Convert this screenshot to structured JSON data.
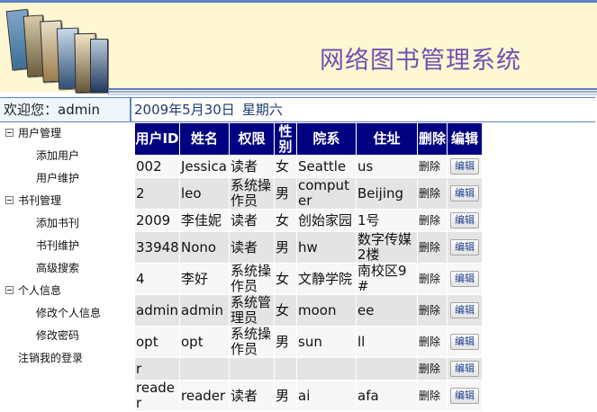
{
  "header": {
    "title": "网络图书管理系统",
    "title_color": "#7050b4",
    "stripe_color": "#5c82c4"
  },
  "welcome": {
    "greeting": "欢迎您：admin",
    "date": "2009年5月30日",
    "weekday": "星期六"
  },
  "sidebar": {
    "groups": [
      {
        "label": "用户管理",
        "items": [
          {
            "label": "添加用户"
          },
          {
            "label": "用户维护"
          }
        ]
      },
      {
        "label": "书刊管理",
        "items": [
          {
            "label": "添加书刊"
          },
          {
            "label": "书刊维护"
          },
          {
            "label": "高级搜索"
          }
        ]
      },
      {
        "label": "个人信息",
        "items": [
          {
            "label": "修改个人信息"
          },
          {
            "label": "修改密码"
          }
        ]
      }
    ],
    "logout": "注销我的登录"
  },
  "table": {
    "headers": {
      "id": "用户ID",
      "name": "姓名",
      "role": "权限",
      "gender": "性别",
      "dept": "院系",
      "address": "住址",
      "delete": "删除",
      "edit": "编辑"
    },
    "delete_label": "删除",
    "edit_label": "编辑",
    "rows": [
      {
        "id": "002",
        "name": "Jessica",
        "role": "读者",
        "gender": "女",
        "dept": "Seattle",
        "address": "us"
      },
      {
        "id": "2",
        "name": "leo",
        "role": "系统操作员",
        "gender": "男",
        "dept": "computer",
        "address": "Beijing"
      },
      {
        "id": "2009",
        "name": "李佳妮",
        "role": "读者",
        "gender": "女",
        "dept": "创始家园",
        "address": "1号"
      },
      {
        "id": "33948",
        "name": "Nono",
        "role": "读者",
        "gender": "男",
        "dept": "hw",
        "address": "数字传媒2楼"
      },
      {
        "id": "4",
        "name": "李好",
        "role": "系统操作员",
        "gender": "女",
        "dept": "文静学院",
        "address": "南校区9#"
      },
      {
        "id": "admin",
        "name": "admin",
        "role": "系统管理员",
        "gender": "女",
        "dept": "moon",
        "address": "ee"
      },
      {
        "id": "opt",
        "name": "opt",
        "role": "系统操作员",
        "gender": "男",
        "dept": "sun",
        "address": "ll"
      },
      {
        "id": "r",
        "name": "",
        "role": "",
        "gender": "",
        "dept": "",
        "address": ""
      },
      {
        "id": "reader",
        "name": "reader",
        "role": "读者",
        "gender": "男",
        "dept": "ai",
        "address": "afa"
      }
    ]
  }
}
